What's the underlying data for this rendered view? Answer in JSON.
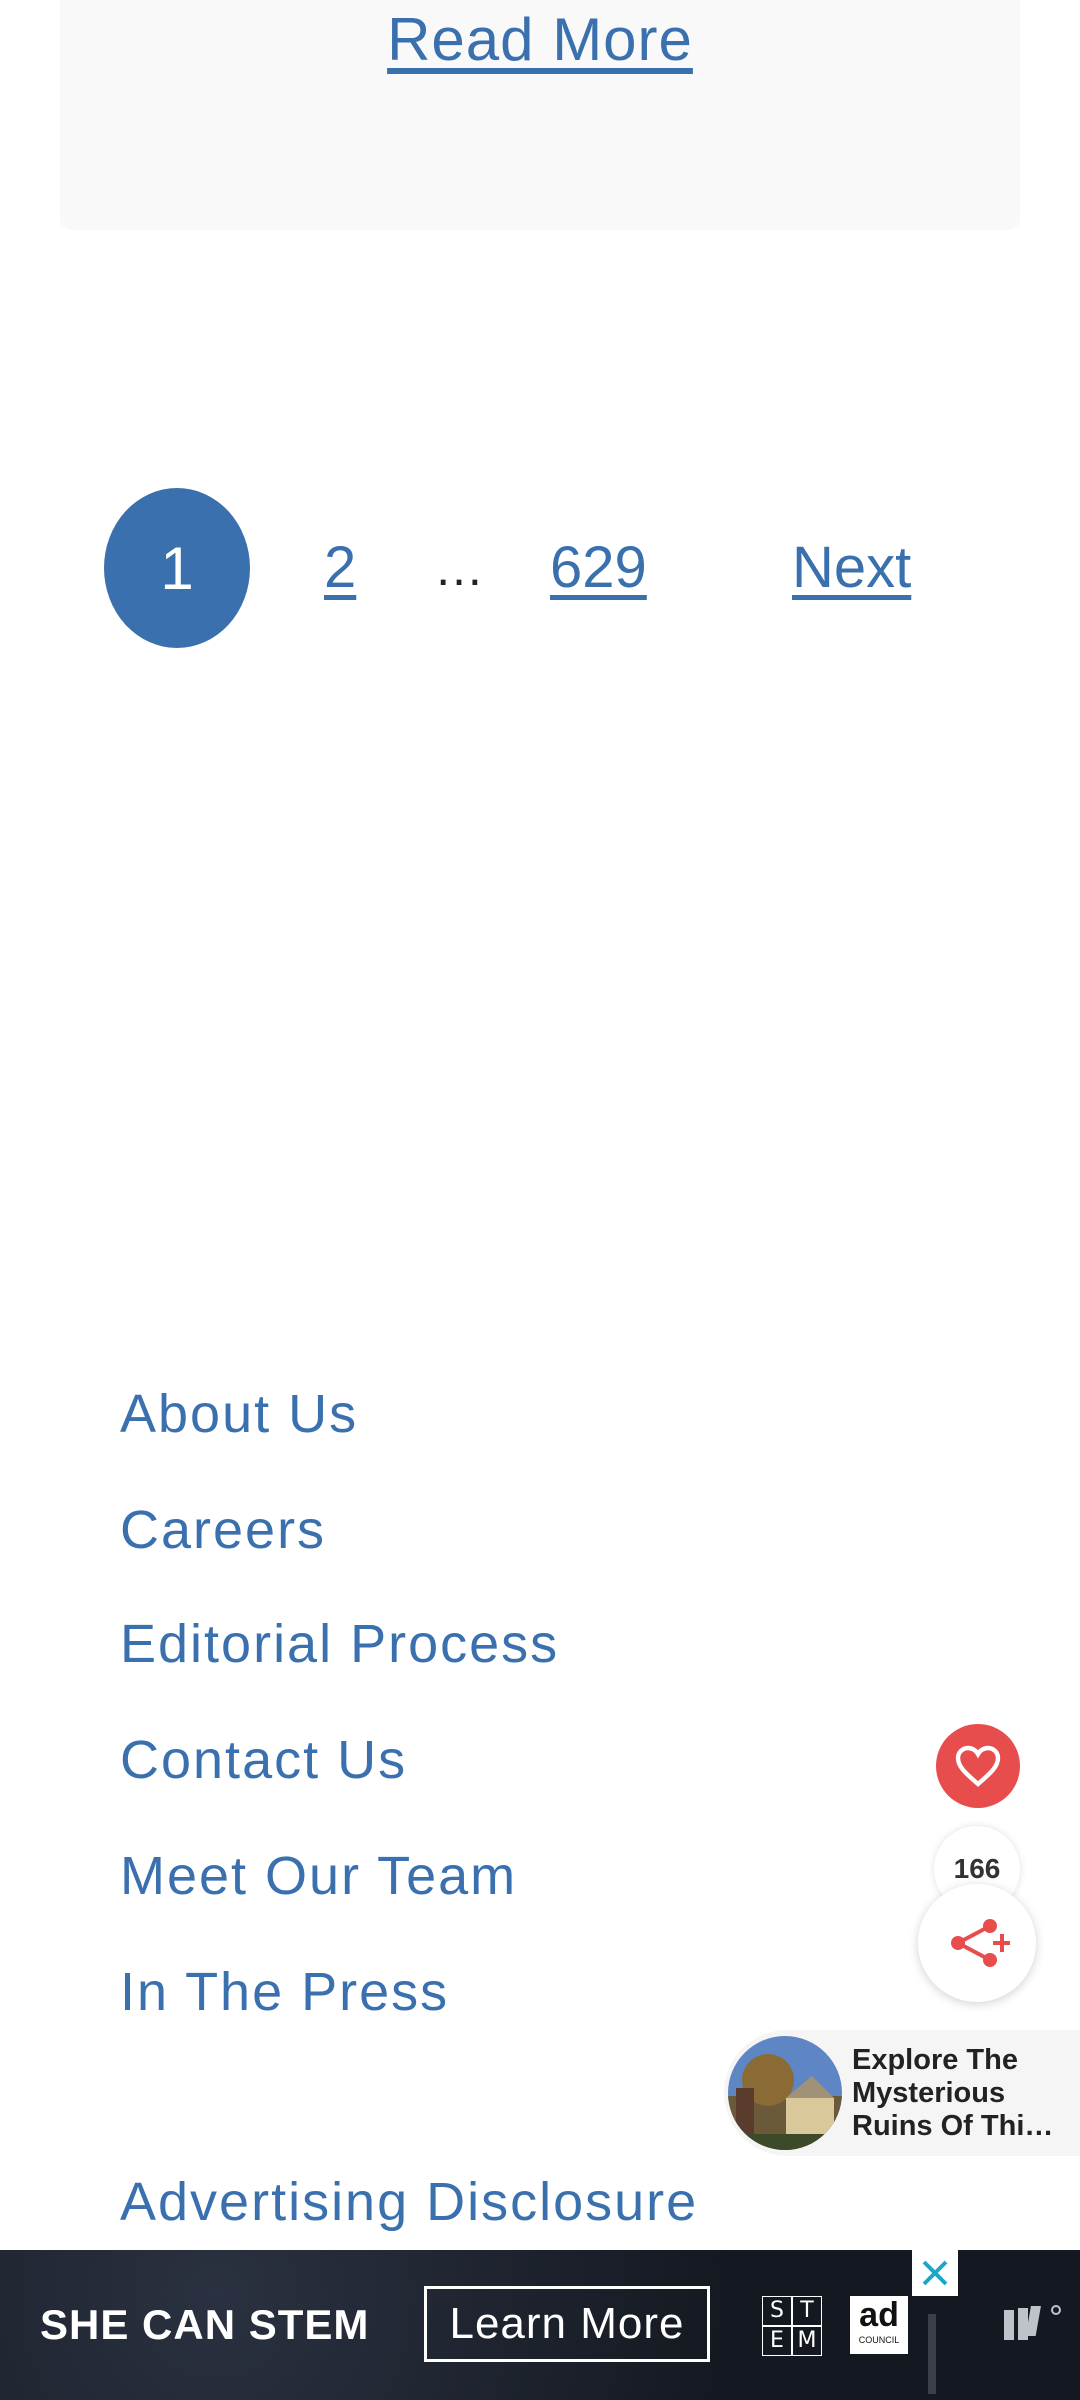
{
  "article_card": {
    "read_more_label": "Read More"
  },
  "pagination": {
    "current_page": "1",
    "pages": [
      "2",
      "629"
    ],
    "ellipsis": "…",
    "next_label": "Next"
  },
  "footer": {
    "links": [
      "About Us",
      "Careers",
      "Editorial Process",
      "Contact Us",
      "Meet Our Team",
      "In The Press"
    ],
    "advertising_label": "Advertising Disclosure"
  },
  "social": {
    "share_count": "166",
    "accent_color": "#e84d4d"
  },
  "promo": {
    "line1": "Explore The",
    "line2": "Mysterious",
    "line3": "Ruins Of Thi…"
  },
  "ad": {
    "headline": "SHE CAN STEM",
    "cta_label": "Learn More",
    "stem_letters": [
      "S",
      "T",
      "E",
      "M"
    ],
    "adcouncil_main": "ad",
    "adcouncil_sub": "COUNCIL"
  },
  "colors": {
    "link": "#3a70ae",
    "current_page_bg": "#3a70ae",
    "card_bg": "#f9f9f9"
  }
}
